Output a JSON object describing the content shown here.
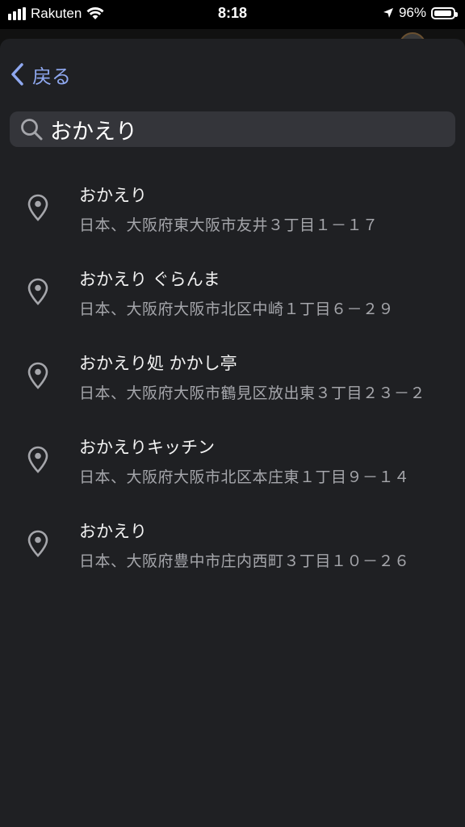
{
  "status_bar": {
    "carrier": "Rakuten",
    "time": "8:18",
    "battery": "96%",
    "battery_level": 0.96,
    "icons": [
      "signal-icon",
      "wifi-icon",
      "location-arrow-icon",
      "battery-icon"
    ]
  },
  "navigation": {
    "back_label": "戻る"
  },
  "search": {
    "value": "おかえり",
    "placeholder": ""
  },
  "results": [
    {
      "name": "おかえり",
      "address": "日本、大阪府東大阪市友井３丁目１－１７"
    },
    {
      "name": "おかえり ぐらんま",
      "address": "日本、大阪府大阪市北区中崎１丁目６－２９"
    },
    {
      "name": "おかえり処 かかし亭",
      "address": "日本、大阪府大阪市鶴見区放出東３丁目２３－２"
    },
    {
      "name": "おかえりキッチン",
      "address": "日本、大阪府大阪市北区本庄東１丁目９－１４"
    },
    {
      "name": "おかえり",
      "address": "日本、大阪府豊中市庄内西町３丁目１０－２６"
    }
  ],
  "colors": {
    "sheet_background": "#1f2023",
    "search_background": "#34353a",
    "accent": "#8fa8f0",
    "secondary_text": "#a5a6ab"
  }
}
